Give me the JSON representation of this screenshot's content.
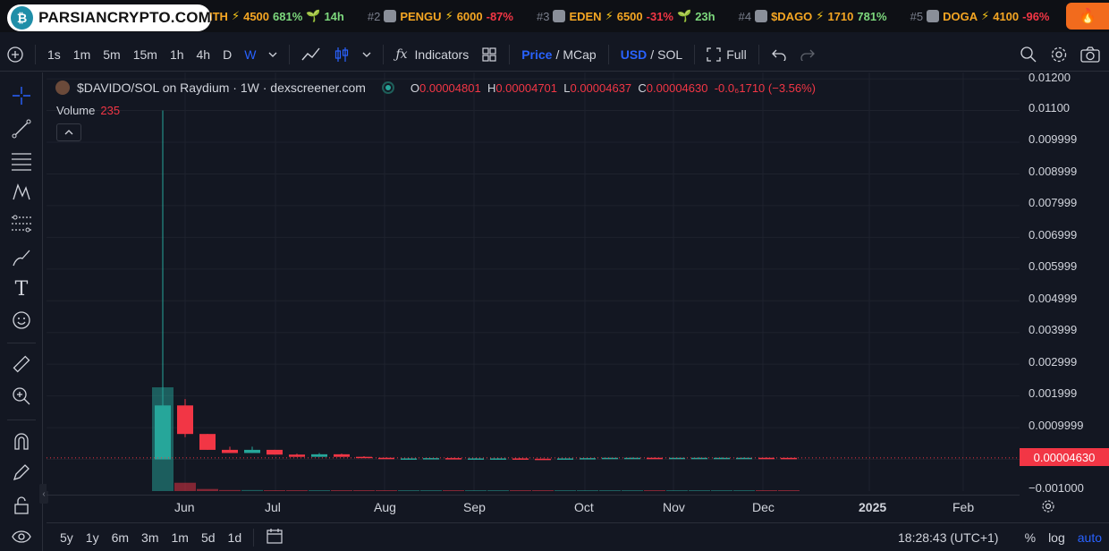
{
  "ticker": {
    "logo_text": "PARSIANCRYPTO.COM",
    "items": [
      {
        "rank": "",
        "name": "ITH",
        "score": "4500",
        "pct": "681%",
        "pct_dir": "up",
        "age": "14h"
      },
      {
        "rank": "#2",
        "name": "PENGU",
        "score": "6000",
        "pct": "-87%",
        "pct_dir": "down",
        "age": ""
      },
      {
        "rank": "#3",
        "name": "EDEN",
        "score": "6500",
        "pct": "-31%",
        "pct_dir": "down",
        "age": "23h"
      },
      {
        "rank": "#4",
        "name": "$DAGO",
        "score": "1710",
        "pct": "781%",
        "pct_dir": "up",
        "age": ""
      },
      {
        "rank": "#5",
        "name": "DOGA",
        "score": "4100",
        "pct": "-96%",
        "pct_dir": "down",
        "age": ""
      }
    ]
  },
  "toolbar": {
    "intervals": [
      "1s",
      "1m",
      "5m",
      "15m",
      "1h",
      "4h",
      "D",
      "W"
    ],
    "active_interval": "W",
    "indicators_label": "Indicators",
    "price_label": "Price",
    "mcap_label": "MCap",
    "usd_label": "USD",
    "sol_label": "SOL",
    "full_label": "Full"
  },
  "legend": {
    "title": "$DAVIDO/SOL on Raydium · 1W · dexscreener.com",
    "o_key": "O",
    "o_val": "0.00004801",
    "h_key": "H",
    "h_val": "0.00004701",
    "l_key": "L",
    "l_val": "0.00004637",
    "c_key": "C",
    "c_val": "0.00004630",
    "change": "-0.0₆1710 (−3.56%)",
    "volume_key": "Volume",
    "volume_val": "235"
  },
  "price_axis": {
    "ticks": [
      "0.01200",
      "0.01100",
      "0.009999",
      "0.008999",
      "0.007999",
      "0.006999",
      "0.005999",
      "0.004999",
      "0.003999",
      "0.002999",
      "0.001999",
      "0.0009999",
      "−0.001000"
    ],
    "current_price": "0.00004630"
  },
  "time_axis": {
    "labels": [
      "Jun",
      "Jul",
      "Aug",
      "Sep",
      "Oct",
      "Nov",
      "Dec",
      "2025",
      "Feb"
    ]
  },
  "bottombar": {
    "ranges": [
      "5y",
      "1y",
      "6m",
      "3m",
      "1m",
      "5d",
      "1d"
    ],
    "clock": "18:28:43 (UTC+1)",
    "percent_label": "%",
    "log_label": "log",
    "auto_label": "auto"
  },
  "chart_data": {
    "type": "candlestick",
    "title": "$DAVIDO/SOL on Raydium · 1W · dexscreener.com",
    "x": [
      "May-W4",
      "Jun-W1",
      "Jun-W2",
      "Jun-W3",
      "Jun-W4",
      "Jul-W1",
      "Jul-W2",
      "Jul-W3",
      "Jul-W4",
      "Aug-W1",
      "Aug-W2",
      "Aug-W3",
      "Aug-W4",
      "Sep-W1",
      "Sep-W2",
      "Sep-W3",
      "Sep-W4",
      "Oct-W1",
      "Oct-W2",
      "Oct-W3",
      "Oct-W4",
      "Nov-W1",
      "Nov-W2",
      "Nov-W3",
      "Nov-W4",
      "Dec-W1",
      "Dec-W2",
      "Dec-W3",
      "Dec-W4"
    ],
    "ohlc": [
      [
        0.0,
        0.011,
        0.0,
        0.0017
      ],
      [
        0.0017,
        0.0019,
        0.0007,
        0.0008
      ],
      [
        0.0008,
        0.0008,
        0.0003,
        0.0003
      ],
      [
        0.0003,
        0.0004,
        0.0002,
        0.0002
      ],
      [
        0.0002,
        0.0004,
        0.0002,
        0.0003
      ],
      [
        0.0003,
        0.0003,
        0.00015,
        0.00015
      ],
      [
        0.00015,
        0.00018,
        8e-05,
        8e-05
      ],
      [
        8e-05,
        0.0002,
        8e-05,
        0.00016
      ],
      [
        0.00016,
        0.00018,
        8e-05,
        8e-05
      ],
      [
        8e-05,
        0.0001,
        5e-05,
        5e-05
      ],
      [
        5e-05,
        6e-05,
        2e-05,
        2e-05
      ],
      [
        2e-05,
        4e-05,
        2e-05,
        3e-05
      ],
      [
        3e-05,
        4e-05,
        2e-05,
        4e-05
      ],
      [
        4e-05,
        5e-05,
        2e-05,
        2e-05
      ],
      [
        2e-05,
        4e-05,
        2e-05,
        3e-05
      ],
      [
        3e-05,
        4e-05,
        2e-05,
        3e-05
      ],
      [
        3e-05,
        4e-05,
        2e-05,
        2e-05
      ],
      [
        2e-05,
        3e-05,
        1e-05,
        1e-05
      ],
      [
        1e-05,
        3e-05,
        1e-05,
        3e-05
      ],
      [
        3e-05,
        4e-05,
        2e-05,
        4e-05
      ],
      [
        4e-05,
        5e-05,
        3e-05,
        5e-05
      ],
      [
        5e-05,
        6e-05,
        4e-05,
        5e-05
      ],
      [
        5e-05,
        6e-05,
        4e-05,
        4e-05
      ],
      [
        4e-05,
        5e-05,
        3e-05,
        5e-05
      ],
      [
        5e-05,
        6e-05,
        4e-05,
        5e-05
      ],
      [
        5e-05,
        6e-05,
        4e-05,
        5e-05
      ],
      [
        5e-05,
        6e-05,
        4e-05,
        5e-05
      ],
      [
        5e-05,
        6e-05,
        4e-05,
        4.8e-05
      ],
      [
        4.801e-05,
        4.801e-05,
        4.637e-05,
        4.63e-05
      ]
    ],
    "ylim": [
      -0.001,
      0.0122
    ],
    "up_color": "#26a69a",
    "down_color": "#f23645",
    "last_price": 4.63e-05,
    "grid": true
  }
}
